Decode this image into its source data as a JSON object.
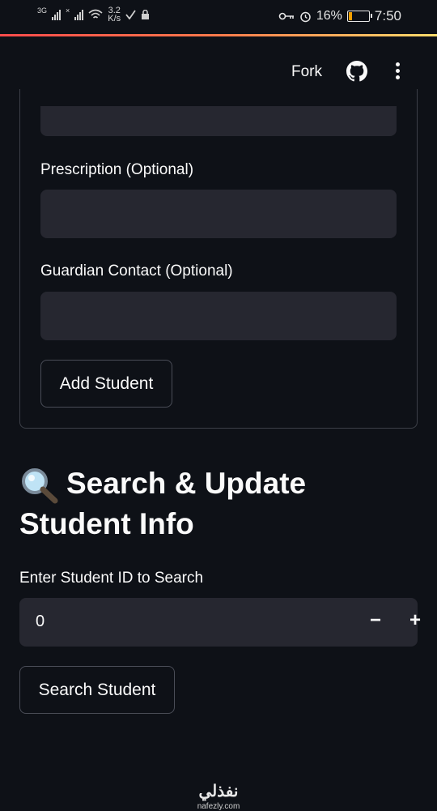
{
  "status_bar": {
    "network": "3G",
    "speed_value": "3.2",
    "speed_unit": "K/s",
    "battery": "16%",
    "time": "7:50"
  },
  "header": {
    "fork_label": "Fork"
  },
  "form": {
    "prescription_label": "Prescription (Optional)",
    "guardian_label": "Guardian Contact (Optional)",
    "add_button": "Add Student"
  },
  "search_section": {
    "title_line1": "Search & Update",
    "title_line2": "Student Info",
    "id_label": "Enter Student ID to Search",
    "id_value": "0",
    "minus": "−",
    "plus": "+",
    "search_button": "Search Student"
  },
  "watermark": {
    "arabic": "نفذلي",
    "latin": "nafezly.com"
  },
  "colors": {
    "background": "#0e1117",
    "input_bg": "#262730",
    "text": "#fafafa",
    "accent_start": "#ff4b4b",
    "accent_end": "#ffdc6b"
  }
}
